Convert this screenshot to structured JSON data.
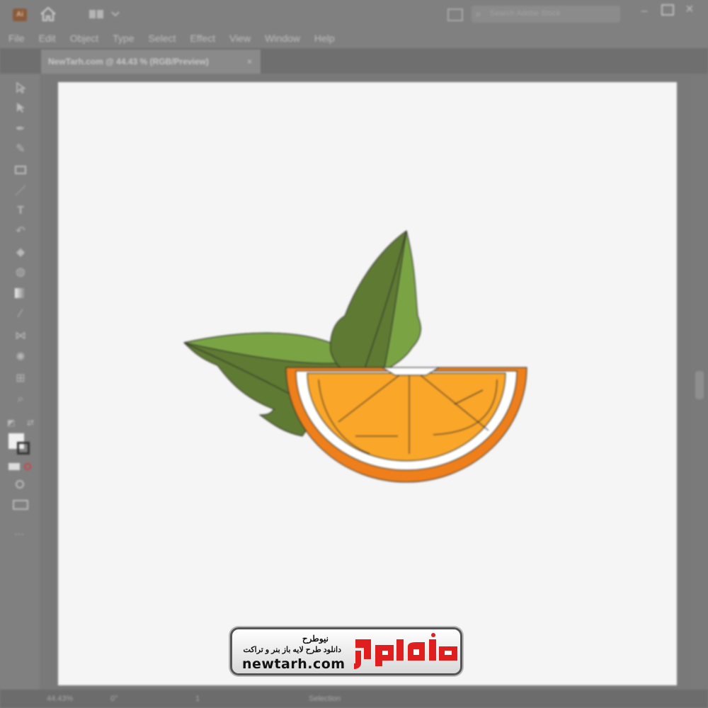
{
  "app": {
    "logo_text": "Ai",
    "search_placeholder": "Search Adobe Stock"
  },
  "menu": [
    "File",
    "Edit",
    "Object",
    "Type",
    "Select",
    "Effect",
    "View",
    "Window",
    "Help"
  ],
  "document_tab": {
    "title": "NewTarh.com @ 44.43 % (RGB/Preview)",
    "close": "×"
  },
  "tools": [
    "selection-tool",
    "direct-selection-tool",
    "pen-tool",
    "curvature-tool",
    "rectangle-tool",
    "paintbrush-tool",
    "type-tool",
    "rotate-tool",
    "eraser-tool",
    "shape-builder-tool",
    "gradient-tool",
    "eyedropper-tool",
    "blend-tool",
    "symbol-sprayer-tool",
    "artboard-tool",
    "zoom-tool"
  ],
  "status": {
    "zoom": "44.43%",
    "rotation": "0°",
    "artboard_index": "1",
    "tool_name": "Selection"
  },
  "colors": {
    "leaf_dark": "#5e7a33",
    "leaf_light": "#7aa444",
    "peel": "#ef7f1a",
    "pith": "#ffffff",
    "flesh": "#faa629",
    "outline": "#2b2b2b",
    "logo_red": "#e01e1e"
  },
  "watermark": {
    "name_fa": "نیوطرح",
    "tagline_fa": "دانلود طرح لایه باز بنر و تراکت",
    "url": "newtarh.com",
    "mark_fa": "نیوطرح"
  }
}
